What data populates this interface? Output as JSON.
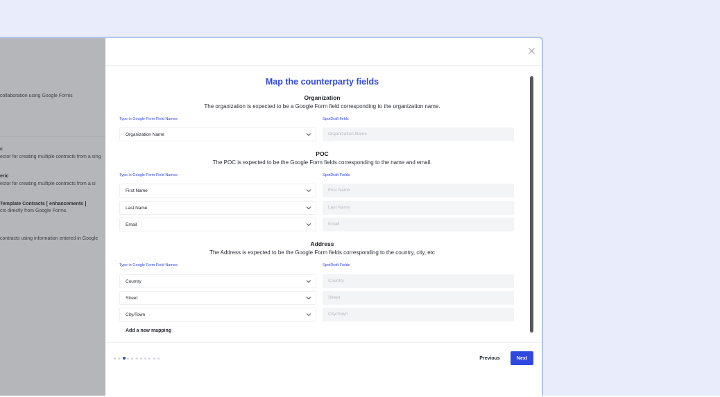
{
  "background_list": [
    {
      "title": "",
      "desc": "collaboration using Google Forms"
    },
    {
      "title": "c",
      "desc": "ector for creating multiple contracts from a sing"
    },
    {
      "title": "eric",
      "desc": "ector for creating multiple contracts from a si"
    },
    {
      "title": "Template Contracts [ enhancements ]",
      "desc": "cts directly from Google Forms."
    },
    {
      "title": "",
      "desc": "contracts using information entered in Google"
    }
  ],
  "modal": {
    "title": "Map the counterparty fields",
    "sections": [
      {
        "title": "Organization",
        "description": "The organization is expected to be a Google Form field corresponding to the organization name.",
        "left_label": "Type in Google Form Field Names",
        "right_label": "SpotDraft fields",
        "rows": [
          {
            "select": "Organization Name",
            "field": "Organization Name"
          }
        ]
      },
      {
        "title": "POC",
        "description": "The POC is expected to be the Google Form fields corresponding to the name and email.",
        "left_label": "Type in Google Form Field Names",
        "right_label": "SpotDraft Fields",
        "rows": [
          {
            "select": "First Name",
            "field": "First Name"
          },
          {
            "select": "Last Name",
            "field": "Last Name"
          },
          {
            "select": "Email",
            "field": "Email"
          }
        ]
      },
      {
        "title": "Address",
        "description": "The Address is expected to be the Google Form fields corresponding to the country, city, etc",
        "left_label": "Type in Google Form Field Names",
        "right_label": "SpotDraft Fields",
        "rows": [
          {
            "select": "Country",
            "field": "Country"
          },
          {
            "select": "Street",
            "field": "Street"
          },
          {
            "select": "City/Town",
            "field": "City/Town"
          }
        ]
      }
    ],
    "add_mapping_label": "Add a new mapping",
    "stepper": {
      "total": 11,
      "current": 3
    },
    "previous_label": "Previous",
    "next_label": "Next"
  },
  "colors": {
    "accent": "#2f48e0",
    "page_background": "#e8ecfb",
    "overlay": "#b4b6b9",
    "readonly_field": "#f3f4f6"
  },
  "icons": {
    "close": "close-icon",
    "dropdown": "chevron-down-icon"
  }
}
